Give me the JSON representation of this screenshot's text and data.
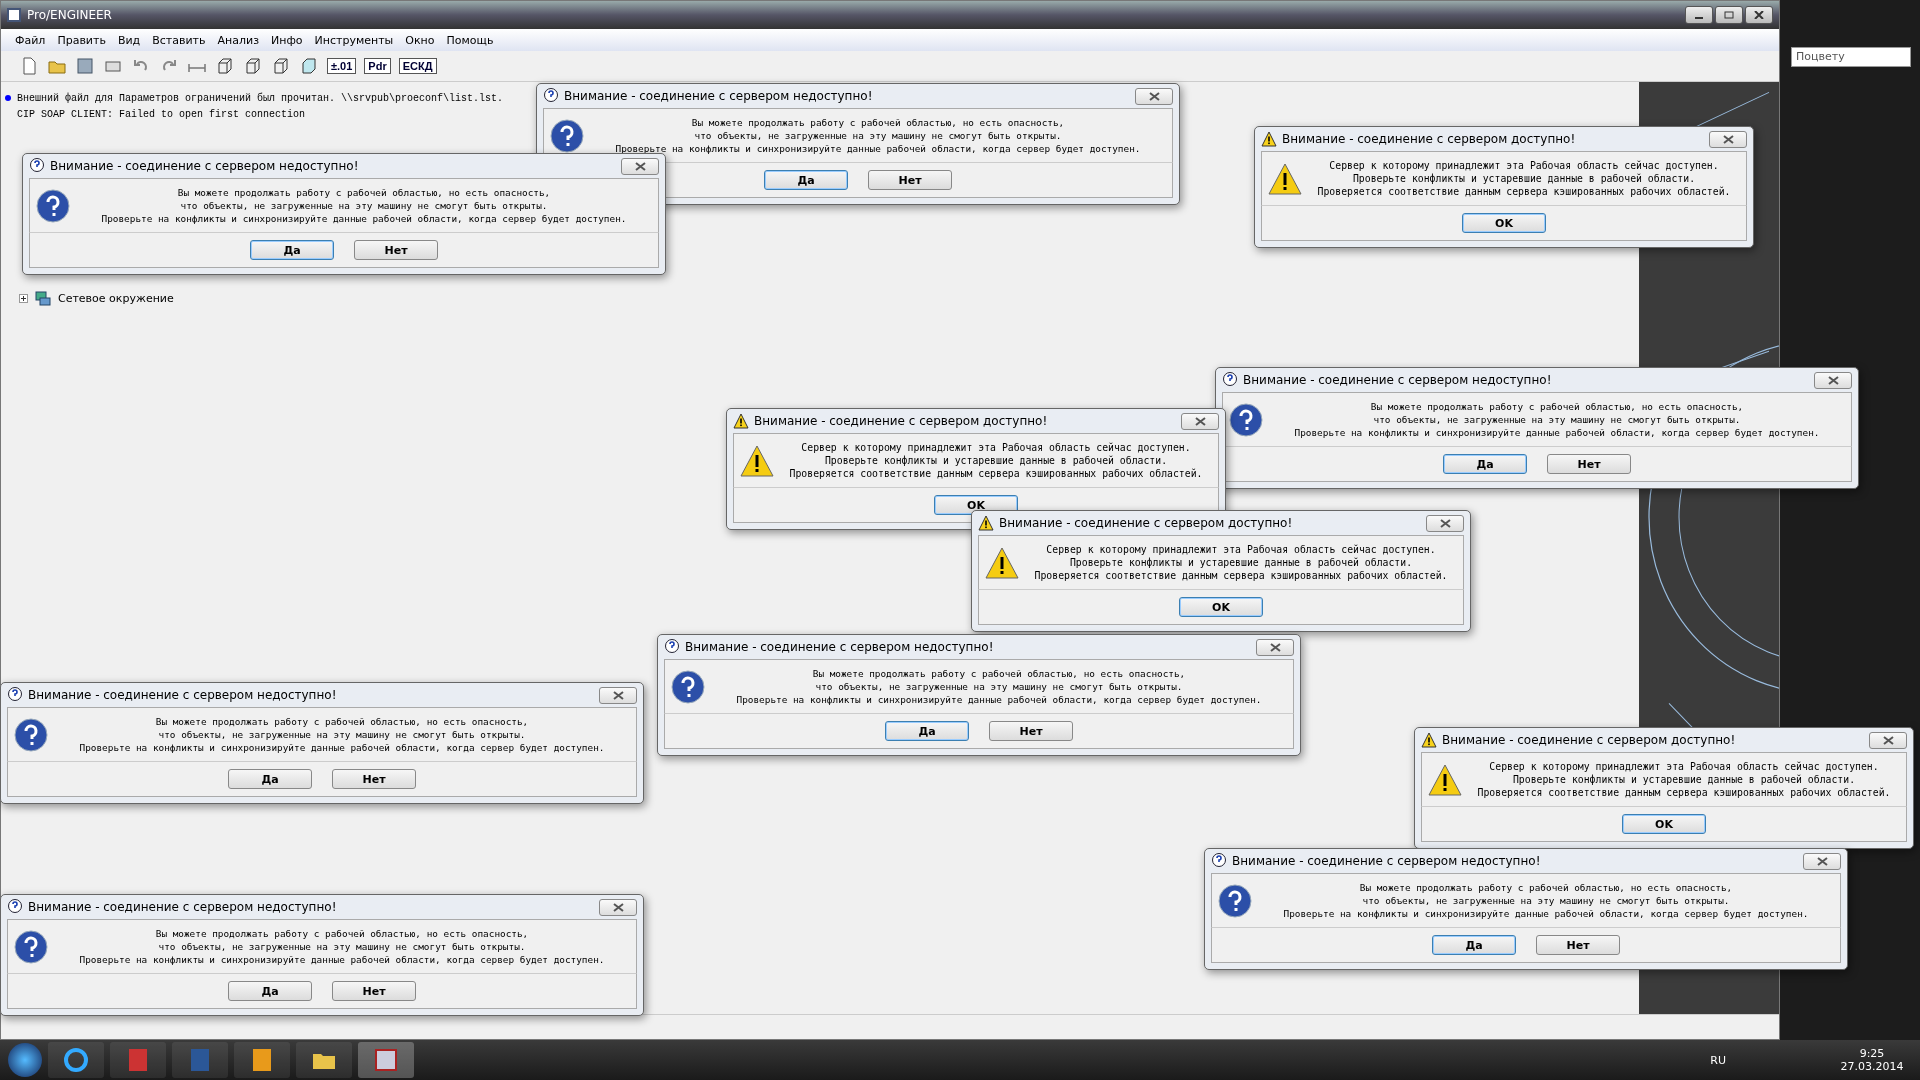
{
  "window": {
    "title": "Pro/ENGINEER"
  },
  "menu": [
    "Файл",
    "Править",
    "Вид",
    "Вставить",
    "Анализ",
    "Инфо",
    "Инструменты",
    "Окно",
    "Помощь"
  ],
  "toolbar_labels": [
    "±.01",
    "Pdr",
    "ЕСКД"
  ],
  "messages": [
    {
      "kind": "info",
      "text": "Внешний файл для Параметров ограничений был прочитан. \\\\srvpub\\proeconf\\list.lst."
    },
    {
      "kind": "plain",
      "text": "CIP SOAP CLIENT: Failed to open first connection"
    }
  ],
  "tree": [
    {
      "label": "Сетевое окружение",
      "expanded": false
    }
  ],
  "side_panel": {
    "filter": "Поцвету"
  },
  "dialogs": [
    {
      "kind": "warning",
      "title": "Внимание - соединение с сервером доступно!",
      "message": [
        "Сервер к которому принадлежит эта Рабочая область сейчас доступен.",
        "Проверьте конфликты и устаревшие данные в рабочей области.",
        "Проверяется соответствие данным сервера кэшированных рабочих областей."
      ],
      "buttons": [
        {
          "label": "OK",
          "selected": true
        }
      ]
    },
    {
      "kind": "question",
      "title": "Внимание - соединение с сервером недоступно!",
      "message": [
        "Вы можете продолжать работу с рабочей областью, но есть опасность,",
        "что объекты, не загруженные на эту машину не смогут быть открыты.",
        "Проверьте на конфликты и синхронизируйте данные рабочей области, когда сервер будет доступен."
      ],
      "buttons": [
        {
          "label": "Да",
          "selected": true
        },
        {
          "label": "Нет",
          "selected": false
        }
      ]
    },
    {
      "kind": "question",
      "title": "Внимание - соединение с сервером недоступно!",
      "message": [
        "Вы можете продолжать работу с рабочей областью, но есть опасность,",
        "что объекты, не загруженные на эту машину не смогут быть открыты.",
        "Проверьте на конфликты и синхронизируйте данные рабочей области, когда сервер будет доступен."
      ],
      "buttons": [
        {
          "label": "Да",
          "selected": true
        },
        {
          "label": "Нет",
          "selected": false
        }
      ]
    },
    {
      "kind": "question",
      "title": "Внимание - соединение с сервером недоступно!",
      "message": [
        "Вы можете продолжать работу с рабочей областью, но есть опасность,",
        "что объекты, не загруженные на эту машину не смогут быть открыты.",
        "Проверьте на конфликты и синхронизируйте данные рабочей области, когда сервер будет доступен."
      ],
      "buttons": [
        {
          "label": "Да",
          "selected": true
        },
        {
          "label": "Нет",
          "selected": false
        }
      ]
    },
    {
      "kind": "warning",
      "title": "Внимание - соединение с сервером доступно!",
      "message": [
        "Сервер к которому принадлежит эта Рабочая область сейчас доступен.",
        "Проверьте конфликты и устаревшие данные в рабочей области.",
        "Проверяется соответствие данным сервера кэшированных рабочих областей."
      ],
      "buttons": [
        {
          "label": "OK",
          "selected": true
        }
      ]
    },
    {
      "kind": "warning",
      "title": "Внимание - соединение с сервером доступно!",
      "message": [
        "Сервер к которому принадлежит эта Рабочая область сейчас доступен.",
        "Проверьте конфликты и устаревшие данные в рабочей области.",
        "Проверяется соответствие данным сервера кэшированных рабочих областей."
      ],
      "buttons": [
        {
          "label": "OK",
          "selected": true
        }
      ]
    },
    {
      "kind": "question",
      "title": "Внимание - соединение с сервером недоступно!",
      "message": [
        "Вы можете продолжать работу с рабочей областью, но есть опасность,",
        "что объекты, не загруженные на эту машину не смогут быть открыты.",
        "Проверьте на конфликты и синхронизируйте данные рабочей области, когда сервер будет доступен."
      ],
      "buttons": [
        {
          "label": "Да",
          "selected": false
        },
        {
          "label": "Нет",
          "selected": false
        }
      ]
    },
    {
      "kind": "question",
      "title": "Внимание - соединение с сервером недоступно!",
      "message": [
        "Вы можете продолжать работу с рабочей областью, но есть опасность,",
        "что объекты, не загруженные на эту машину не смогут быть открыты.",
        "Проверьте на конфликты и синхронизируйте данные рабочей области, когда сервер будет доступен."
      ],
      "buttons": [
        {
          "label": "Да",
          "selected": true
        },
        {
          "label": "Нет",
          "selected": false
        }
      ]
    },
    {
      "kind": "warning",
      "title": "Внимание - соединение с сервером доступно!",
      "message": [
        "Сервер к которому принадлежит эта Рабочая область сейчас доступен.",
        "Проверьте конфликты и устаревшие данные в рабочей области.",
        "Проверяется соответствие данным сервера кэшированных рабочих областей."
      ],
      "buttons": [
        {
          "label": "OK",
          "selected": true
        }
      ]
    },
    {
      "kind": "question",
      "title": "Внимание - соединение с сервером недоступно!",
      "message": [
        "Вы можете продолжать работу с рабочей областью, но есть опасность,",
        "что объекты, не загруженные на эту машину не смогут быть открыты.",
        "Проверьте на конфликты и синхронизируйте данные рабочей области, когда сервер будет доступен."
      ],
      "buttons": [
        {
          "label": "Да",
          "selected": true
        },
        {
          "label": "Нет",
          "selected": false
        }
      ]
    },
    {
      "kind": "question",
      "title": "Внимание - соединение с сервером недоступно!",
      "message": [
        "Вы можете продолжать работу с рабочей областью, но есть опасность,",
        "что объекты, не загруженные на эту машину не смогут быть открыты.",
        "Проверьте на конфликты и синхронизируйте данные рабочей области, когда сервер будет доступен."
      ],
      "buttons": [
        {
          "label": "Да",
          "selected": false
        },
        {
          "label": "Нет",
          "selected": false
        }
      ]
    }
  ],
  "taskbar": {
    "language": "RU",
    "time": "9:25",
    "date": "27.03.2014"
  }
}
